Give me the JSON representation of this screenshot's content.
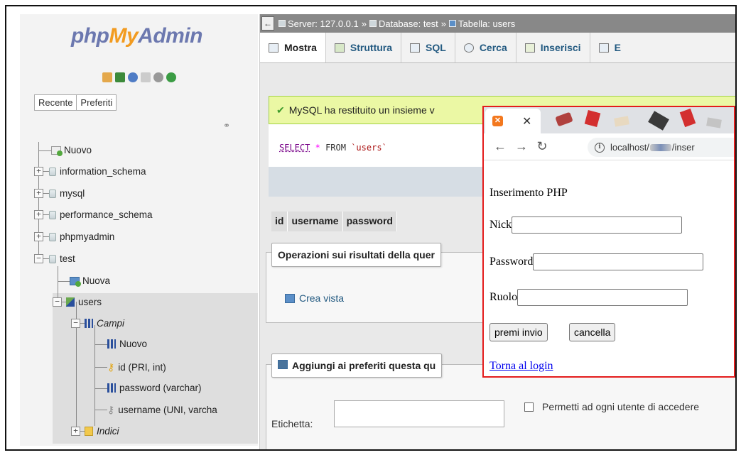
{
  "sidebar": {
    "logo": {
      "part1": "php",
      "part2": "My",
      "part3": "Admin"
    },
    "tabs": [
      "Recente",
      "Preferiti"
    ],
    "tree": {
      "new": "Nuovo",
      "databases": [
        "information_schema",
        "mysql",
        "performance_schema",
        "phpmyadmin",
        "test"
      ],
      "test_children": {
        "new_table": "Nuova",
        "table": "users",
        "columns_group": "Campi",
        "new_column": "Nuovo",
        "columns": [
          "id (PRI, int)",
          "password (varchar)",
          "username (UNI, varcha"
        ],
        "indexes": "Indici"
      }
    }
  },
  "breadcrumb": {
    "server": "Server: 127.0.0.1",
    "database": "Database: test",
    "table": "Tabella: users",
    "sep": "»"
  },
  "tabs": [
    "Mostra",
    "Struttura",
    "SQL",
    "Cerca",
    "Inserisci",
    "E"
  ],
  "main": {
    "success_message": "MySQL ha restituito un insieme v",
    "sql": {
      "kw": "SELECT",
      "op": "*",
      "from": "FROM",
      "table": "`users`"
    },
    "columns": [
      "id",
      "username",
      "password"
    ],
    "ops_legend": "Operazioni sui risultati della quer",
    "create_view": "Crea vista",
    "bookmark_legend": "Aggiungi ai preferiti questa qu",
    "label_field": "Etichetta:",
    "permit_label": "Permetti ad ogni utente di accedere"
  },
  "popup": {
    "tab_icon": "xampp-icon",
    "url_prefix": "localhost/",
    "url_suffix": "/inser",
    "title": "Inserimento PHP",
    "fields": {
      "nick": "Nick",
      "password": "Password",
      "ruolo": "Ruolo"
    },
    "submit": "premi invio",
    "cancel": "cancella",
    "back_link": "Torna al login"
  },
  "colors": {
    "popup_border": "#e41c1c",
    "success_bg": "#ebf8a4",
    "link": "#0000ee",
    "tab_text": "#235a81"
  }
}
